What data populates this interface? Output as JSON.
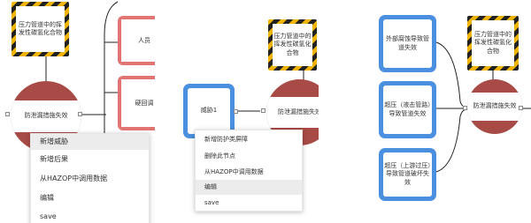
{
  "panel1": {
    "hazard": "压力管道中的挥发性碳氢化合物",
    "consequence_partial_1": "人员",
    "consequence_partial_2": "硬回调",
    "event": "防泄漏措施失效",
    "menu": [
      "新增威胁",
      "新增后果",
      "从HAZOP中调用数据",
      "编辑",
      "save"
    ],
    "highlighted_index": 0
  },
  "panel2": {
    "hazard": "压力管道中的挥发性碳氢化合物",
    "threat": "威胁1",
    "event": "防泄漏措施失效",
    "menu": [
      "新增防护类屏障",
      "删除此节点",
      "从HAZOP中调用数据",
      "编辑",
      "save"
    ],
    "highlighted_index": 3
  },
  "panel3": {
    "hazard": "压力管道中的挥发性碳氢化合物",
    "threats": [
      "外部腐蚀导致管道失效",
      "超压（液击管路）导致管道失效",
      "超压（上游过压）导致管道破坏失效"
    ],
    "event": "防泄漏措施失效"
  },
  "colors": {
    "threat_blue": "#4a8fe0",
    "consequence_red": "#e37474",
    "event_circle": "#a84a45",
    "hazard_yellow": "#f0b400",
    "hazard_black": "#222222"
  }
}
